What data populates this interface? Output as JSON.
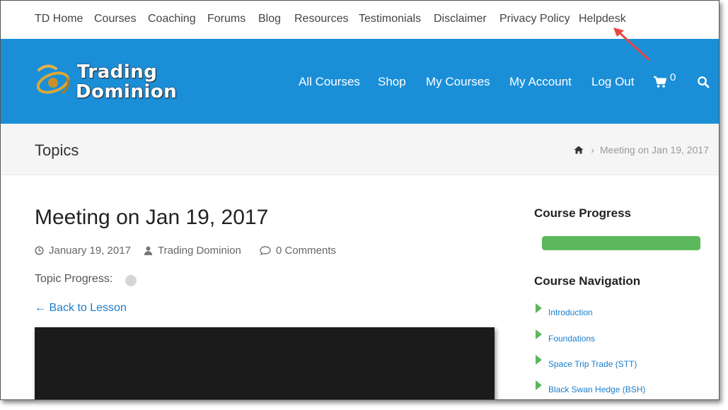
{
  "topnav": [
    "TD Home",
    "Courses",
    "Coaching",
    "Forums",
    "Blog",
    "Resources",
    "Testimonials",
    "Disclaimer",
    "Privacy Policy",
    "Helpdesk"
  ],
  "logo": {
    "line1": "Trading",
    "line2": "Dominion"
  },
  "mainnav": [
    "All Courses",
    "Shop",
    "My Courses",
    "My Account",
    "Log Out"
  ],
  "cart": {
    "count": "0",
    "icon": "cart-icon"
  },
  "search_icon": "search-icon",
  "page_title": "Topics",
  "breadcrumb": {
    "home_icon": "home-icon",
    "separator": "›",
    "current": "Meeting on Jan 19, 2017"
  },
  "post": {
    "title": "Meeting on Jan 19, 2017",
    "date": "January 19, 2017",
    "author": "Trading Dominion",
    "comments": "0 Comments",
    "topic_progress_label": "Topic Progress:",
    "back_link": "← Back to Lesson"
  },
  "sidebar": {
    "progress_heading": "Course Progress",
    "progress_percent": 100,
    "navigation_heading": "Course Navigation",
    "nav_items": [
      "Introduction",
      "Foundations",
      "Space Trip Trade (STT)",
      "Black Swan Hedge (BSH)"
    ]
  },
  "colors": {
    "header_blue": "#1a8fd8",
    "link_blue": "#1a7cc9",
    "progress_green": "#5cb85c",
    "annotation_arrow": "#e8473f"
  }
}
